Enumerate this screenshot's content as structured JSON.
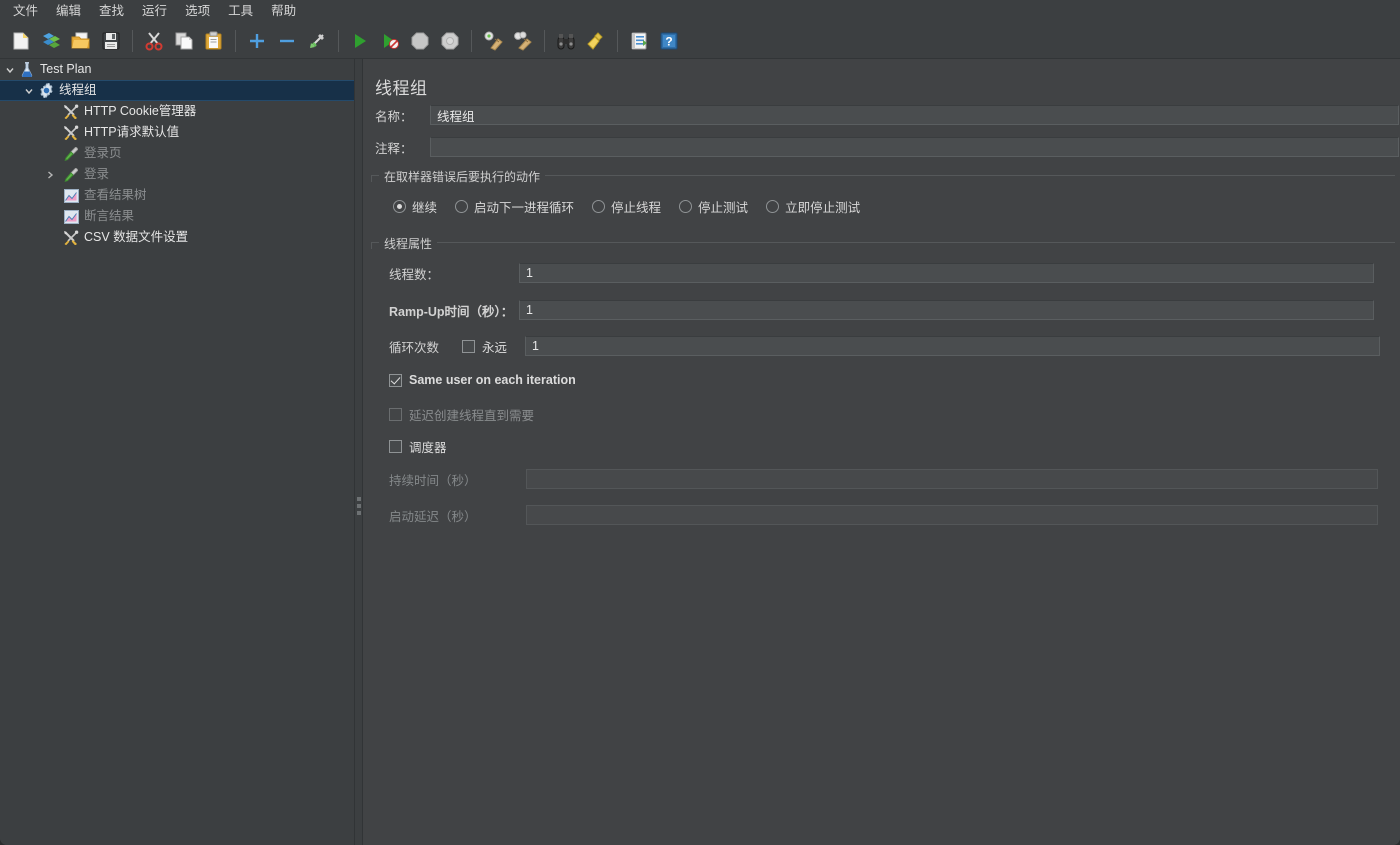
{
  "menubar": {
    "items": [
      {
        "label": "文件",
        "name": "menu-file"
      },
      {
        "label": "编辑",
        "name": "menu-edit"
      },
      {
        "label": "查找",
        "name": "menu-search"
      },
      {
        "label": "运行",
        "name": "menu-run"
      },
      {
        "label": "选项",
        "name": "menu-options"
      },
      {
        "label": "工具",
        "name": "menu-tools"
      },
      {
        "label": "帮助",
        "name": "menu-help"
      }
    ]
  },
  "toolbar": {
    "buttons": [
      {
        "icon": "new-document-icon",
        "label": "新建"
      },
      {
        "icon": "open-templates-icon",
        "label": "模板"
      },
      {
        "icon": "open-folder-icon",
        "label": "打开"
      },
      {
        "icon": "save-floppy-icon",
        "label": "保存"
      },
      {
        "sep": true
      },
      {
        "icon": "cut-scissors-icon",
        "label": "剪切"
      },
      {
        "icon": "copy-icon",
        "label": "复制"
      },
      {
        "icon": "paste-clipboard-icon",
        "label": "粘贴"
      },
      {
        "sep": true
      },
      {
        "icon": "expand-all-plus-icon",
        "label": "展开全部"
      },
      {
        "icon": "collapse-all-minus-icon",
        "label": "收起全部"
      },
      {
        "icon": "toggle-enable-icon",
        "label": "启用/禁用"
      },
      {
        "sep": true
      },
      {
        "icon": "start-play-icon",
        "label": "启动"
      },
      {
        "icon": "start-no-pauses-icon",
        "label": "无暂停启动"
      },
      {
        "icon": "stop-octagon-icon",
        "label": "停止"
      },
      {
        "icon": "shutdown-octagon-icon",
        "label": "关闭"
      },
      {
        "sep": true
      },
      {
        "icon": "clear-broom-icon",
        "label": "清除"
      },
      {
        "icon": "clear-all-broom-icon",
        "label": "清除全部"
      },
      {
        "sep": true
      },
      {
        "icon": "search-binoculars-icon",
        "label": "搜索"
      },
      {
        "icon": "reset-search-broom-icon",
        "label": "重置搜索"
      },
      {
        "sep": true
      },
      {
        "icon": "function-helper-notepad-icon",
        "label": "函数助手对话框"
      },
      {
        "icon": "help-question-icon",
        "label": "帮助"
      }
    ]
  },
  "tree": {
    "nodes": [
      {
        "label": "Test Plan",
        "icon": "test-plan-flask-icon",
        "indent": 0,
        "arrow": "down",
        "selected": false,
        "dim": false,
        "name": "tree-node-test-plan"
      },
      {
        "label": "线程组",
        "icon": "thread-group-gear-icon",
        "indent": 1,
        "arrow": "down",
        "selected": true,
        "dim": false,
        "name": "tree-node-thread-group"
      },
      {
        "label": "HTTP Cookie管理器",
        "icon": "config-element-tools-icon",
        "indent": 2,
        "arrow": "none",
        "selected": false,
        "dim": false,
        "name": "tree-node-http-cookie-manager"
      },
      {
        "label": "HTTP请求默认值",
        "icon": "config-element-tools-icon",
        "indent": 2,
        "arrow": "none",
        "selected": false,
        "dim": false,
        "name": "tree-node-http-request-defaults"
      },
      {
        "label": "登录页",
        "icon": "sampler-pipette-icon",
        "indent": 2,
        "arrow": "none",
        "selected": false,
        "dim": true,
        "name": "tree-node-login-page"
      },
      {
        "label": "登录",
        "icon": "sampler-pipette-icon",
        "indent": 2,
        "arrow": "right",
        "selected": false,
        "dim": true,
        "name": "tree-node-login"
      },
      {
        "label": "查看结果树",
        "icon": "listener-chart-icon",
        "indent": 2,
        "arrow": "none",
        "selected": false,
        "dim": true,
        "name": "tree-node-view-results-tree"
      },
      {
        "label": "断言结果",
        "icon": "listener-chart-icon",
        "indent": 2,
        "arrow": "none",
        "selected": false,
        "dim": true,
        "name": "tree-node-assertion-results"
      },
      {
        "label": "CSV 数据文件设置",
        "icon": "config-element-tools-icon",
        "indent": 2,
        "arrow": "none",
        "selected": false,
        "dim": false,
        "name": "tree-node-csv-data-set-config"
      }
    ]
  },
  "pane": {
    "title": "线程组",
    "name": {
      "label": "名称：",
      "value": "线程组",
      "placeholder": ""
    },
    "comments": {
      "label": "注释：",
      "value": "",
      "placeholder": ""
    },
    "on_sampler_error": {
      "group_title": "在取样器错误后要执行的动作",
      "options": [
        {
          "label": "继续",
          "selected": true,
          "name": "radio-continue"
        },
        {
          "label": "启动下一进程循环",
          "selected": false,
          "name": "radio-start-next-thread-loop"
        },
        {
          "label": "停止线程",
          "selected": false,
          "name": "radio-stop-thread"
        },
        {
          "label": "停止测试",
          "selected": false,
          "name": "radio-stop-test"
        },
        {
          "label": "立即停止测试",
          "selected": false,
          "name": "radio-stop-test-now"
        }
      ]
    },
    "thread_properties": {
      "group_title": "线程属性",
      "num_threads": {
        "label": "线程数：",
        "value": "1"
      },
      "ramp_up": {
        "label": "Ramp-Up时间（秒）：",
        "value": "1"
      },
      "loop_count": {
        "label": "循环次数",
        "forever_label": "永远",
        "forever_checked": false,
        "value": "1"
      },
      "same_user": {
        "label": "Same user on each iteration",
        "checked": true,
        "disabled": false
      },
      "delayed_start": {
        "label": "延迟创建线程直到需要",
        "checked": false,
        "disabled": true
      },
      "scheduler": {
        "label": "调度器",
        "checked": false,
        "disabled": false
      },
      "duration": {
        "label": "持续时间（秒）",
        "value": "",
        "disabled": true
      },
      "startup_delay": {
        "label": "启动延迟（秒）",
        "value": "",
        "disabled": true
      }
    }
  },
  "colors": {
    "window_bg": "#414345",
    "chrome_bg": "#3c3f41",
    "selection_bg": "#173048",
    "selection_border": "#244a6b",
    "input_bg": "#4a4d4f",
    "text": "#e6e6e6",
    "text_dim": "#8b8e90",
    "border": "#55585a"
  }
}
